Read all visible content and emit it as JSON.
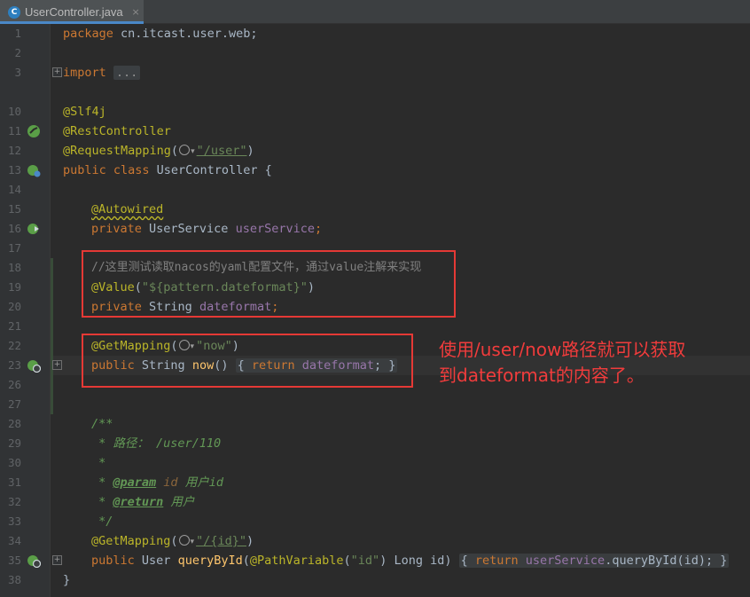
{
  "tab": {
    "icon_letter": "C",
    "title": "UserController.java",
    "close_glyph": "×"
  },
  "line_numbers": [
    "1",
    "2",
    "3",
    "10",
    "11",
    "12",
    "13",
    "14",
    "15",
    "16",
    "17",
    "18",
    "19",
    "20",
    "21",
    "22",
    "23",
    "26",
    "27",
    "28",
    "29",
    "30",
    "31",
    "32",
    "33",
    "34",
    "35",
    "38"
  ],
  "code": {
    "l1_kw": "package",
    "l1_pkg": " cn.itcast.user.web;",
    "l3_kw": "import",
    "l3_ellipsis": "...",
    "l10": "@Slf4j",
    "l11": "@RestController",
    "l12_an": "@RequestMapping",
    "l12_open": "(",
    "l12_url": "\"/user\"",
    "l12_close": ")",
    "l13_kw": "public class",
    "l13_name": " UserController {",
    "l15": "@Autowired",
    "l16_kw": "private",
    "l16_type": " UserService ",
    "l16_field": "userService",
    "l16_semi": ";",
    "l18": "//这里测试读取nacos的yaml配置文件，通过value注解来实现",
    "l19_an": "@Value",
    "l19_open": "(",
    "l19_str": "\"${pattern.dateformat}\"",
    "l19_close": ")",
    "l20_kw": "private",
    "l20_type": " String ",
    "l20_field": "dateformat",
    "l20_semi": ";",
    "l22_an": "@GetMapping",
    "l22_open": "(",
    "l22_str": "\"now\"",
    "l22_close": ")",
    "l23_kw": "public",
    "l23_type": " String ",
    "l23_fn": "now",
    "l23_paren": "() ",
    "l23_open": "{ ",
    "l23_ret": "return",
    "l23_field": " dateformat",
    "l23_semi": "; }",
    "l28": "/**",
    "l29": " * 路径： /user/110",
    "l30": " *",
    "l31_star": " * ",
    "l31_tag": "@param",
    "l31_name": " id",
    "l31_desc": " 用户id",
    "l32_star": " * ",
    "l32_tag": "@return",
    "l32_desc": " 用户",
    "l33": " */",
    "l34_an": "@GetMapping",
    "l34_open": "(",
    "l34_str": "\"/{id}\"",
    "l34_close": ")",
    "l35_kw": "public",
    "l35_type": " User ",
    "l35_fn": "queryById",
    "l35_open": "(",
    "l35_an": "@PathVariable",
    "l35_p1": "(",
    "l35_str": "\"id\"",
    "l35_p2": ") Long id) ",
    "l35_b1": "{ ",
    "l35_ret": "return",
    "l35_field": " userService",
    "l35_call": ".queryById(id);",
    "l35_b2": " }",
    "l38": "}"
  },
  "annotation": {
    "line1": "使用/user/now路径就可以获取",
    "line2": "到dateformat的内容了。"
  },
  "colors": {
    "background": "#2b2b2b",
    "keyword": "#cc7832",
    "annotation": "#bbb529",
    "string": "#6a8759",
    "field": "#9876aa",
    "highlight_box": "#e53935"
  }
}
